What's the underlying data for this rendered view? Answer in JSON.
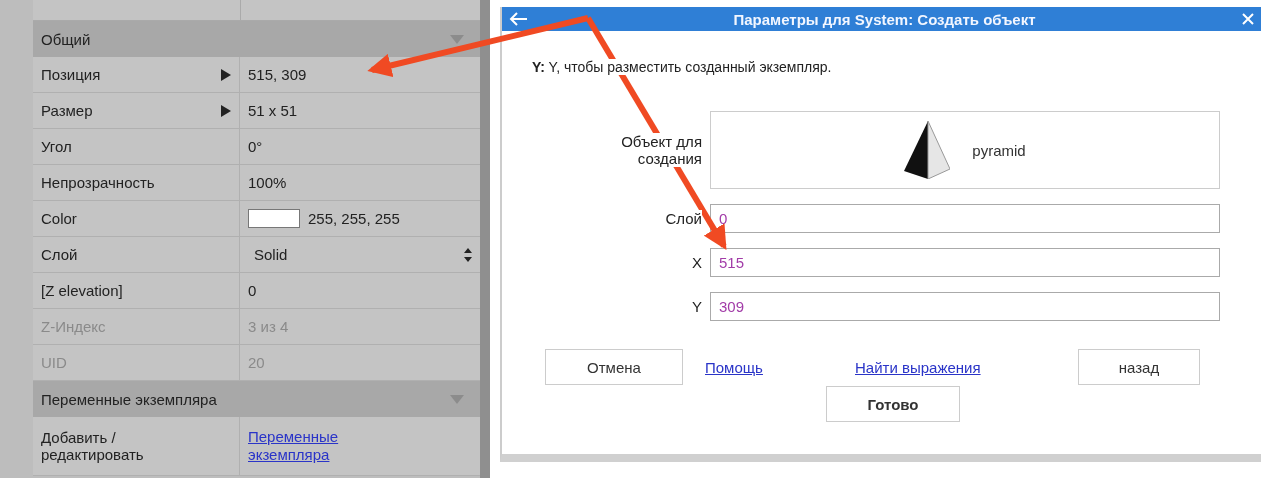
{
  "properties": {
    "sections": [
      {
        "title": "Общий",
        "rows": [
          {
            "label": "Позиция",
            "value": "515,  309",
            "kind": "expand",
            "disabled": false
          },
          {
            "label": "Размер",
            "value": "51 x 51",
            "kind": "expand",
            "disabled": false
          },
          {
            "label": "Угол",
            "value": "0°",
            "kind": "text",
            "disabled": false
          },
          {
            "label": "Непрозрачность",
            "value": "100%",
            "kind": "text",
            "disabled": false
          },
          {
            "label": "Color",
            "value": "255, 255, 255",
            "kind": "color",
            "color": "#ffffff",
            "disabled": false
          },
          {
            "label": "Слой",
            "value": "Solid",
            "kind": "select",
            "disabled": false
          },
          {
            "label": "[Z elevation]",
            "value": "0",
            "kind": "text",
            "disabled": false
          },
          {
            "label": "Z-Индекс",
            "value": "3 из 4",
            "kind": "text",
            "disabled": true
          },
          {
            "label": "UID",
            "value": "20",
            "kind": "text",
            "disabled": true
          }
        ]
      },
      {
        "title": "Переменные экземпляра",
        "rows": [
          {
            "label": "Добавить / редактировать",
            "value": "Переменные экземпляра",
            "kind": "link",
            "disabled": false
          }
        ]
      }
    ]
  },
  "dialog": {
    "title": "Параметры для System: Создать объект",
    "description": "**Y:** Y, чтобы разместить созданный экземпляр.",
    "object_field": {
      "label": "Объект для создания",
      "value": "pyramid"
    },
    "fields": [
      {
        "label": "Слой",
        "value": "0"
      },
      {
        "label": "X",
        "value": "515"
      },
      {
        "label": "Y",
        "value": "309"
      }
    ],
    "buttons": [
      {
        "label": "Отмена",
        "kind": "button"
      },
      {
        "label": "Помощь",
        "kind": "link"
      },
      {
        "label": "Найти выражения",
        "kind": "link"
      },
      {
        "label": "назад",
        "kind": "button"
      },
      {
        "label": "Готово",
        "kind": "default"
      }
    ]
  }
}
